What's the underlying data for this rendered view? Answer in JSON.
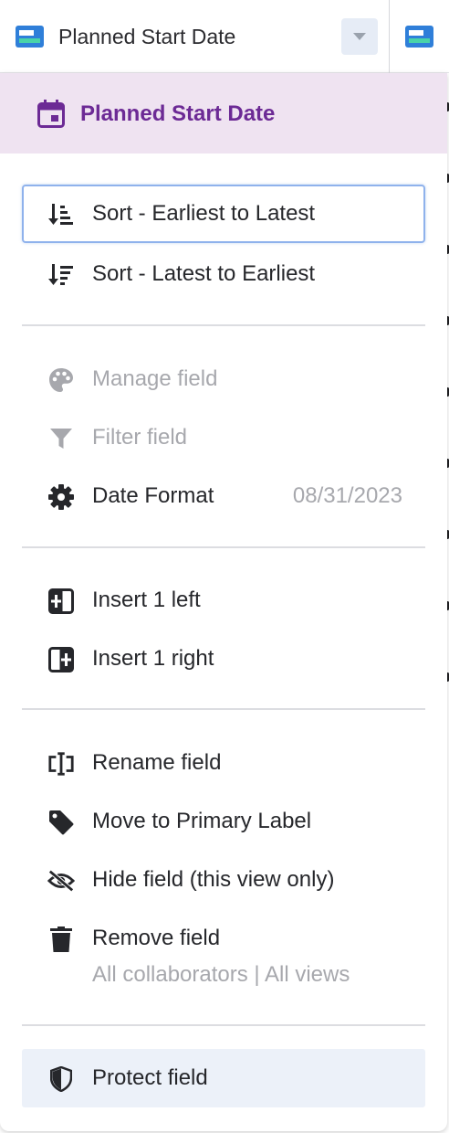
{
  "header": {
    "title": "Planned Start Date",
    "field_icon": "field-card-icon",
    "dropdown_icon": "caret-down-icon"
  },
  "menu": {
    "title": "Planned Start Date",
    "title_icon": "calendar-icon",
    "accent_color": "#6c2a95",
    "header_bg": "#efe3f1",
    "sort": {
      "earliest_to_latest": "Sort - Earliest to Latest",
      "latest_to_earliest": "Sort - Latest to Earliest"
    },
    "field": {
      "manage": "Manage field",
      "filter": "Filter field",
      "date_format": "Date Format",
      "date_format_value": "08/31/2023"
    },
    "insert": {
      "left": "Insert 1 left",
      "right": "Insert 1 right"
    },
    "actions": {
      "rename": "Rename field",
      "move_primary": "Move to Primary Label",
      "hide": "Hide field (this view only)",
      "remove": "Remove field",
      "remove_sub": "All collaborators | All views"
    },
    "protect": "Protect field"
  }
}
